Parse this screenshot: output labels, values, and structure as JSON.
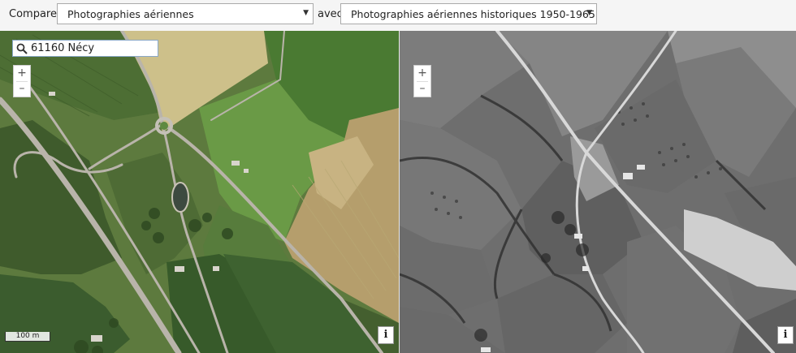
{
  "toolbar": {
    "compare_label": "Comparer",
    "with_label": "avec",
    "left_select_value": "Photographies aériennes",
    "right_select_value": "Photographies aériennes historiques 1950-1965"
  },
  "search": {
    "value": "61160 Nécy",
    "icon": "search-icon"
  },
  "zoom": {
    "in": "+",
    "out": "–"
  },
  "info_label": "i",
  "scale_label": "100 m"
}
